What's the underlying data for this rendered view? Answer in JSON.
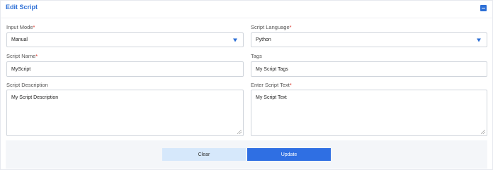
{
  "header": {
    "title": "Edit Script"
  },
  "form": {
    "input_mode": {
      "label": "Input Mode",
      "required": "*",
      "value": "Manual"
    },
    "script_language": {
      "label": "Script Language",
      "required": "*",
      "value": "Python"
    },
    "script_name": {
      "label": "Script Name",
      "required": "*",
      "value": "MyScript"
    },
    "tags": {
      "label": "Tags",
      "value": "My Script Tags"
    },
    "script_description": {
      "label": "Script Description",
      "value": "My Script Description"
    },
    "script_text": {
      "label": "Enter Script Text",
      "required": "*",
      "value": "My Script Text"
    }
  },
  "actions": {
    "clear_label": "Clear",
    "update_label": "Update"
  },
  "colors": {
    "accent": "#2d6fd6",
    "required": "#d93025",
    "clear_bg": "#d6e8fb",
    "update_bg": "#2f6fe3"
  },
  "icons": {
    "collapse": "minus-square-icon",
    "dropdown": "triangle-down-icon",
    "resize": "resize-handle-icon"
  }
}
